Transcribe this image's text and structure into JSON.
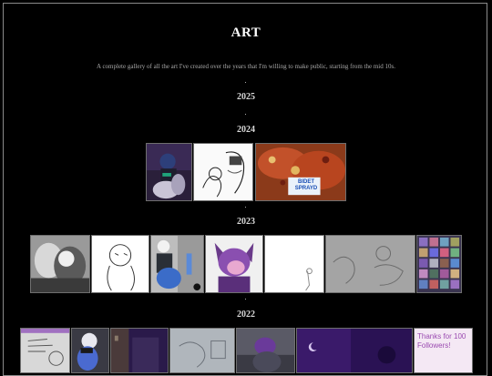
{
  "page": {
    "title": "ART",
    "subtitle": "A complete gallery of all the art I've created over the years that I'm willing to make public, starting from the mid 10s.",
    "separator": "·"
  },
  "years": [
    {
      "label": "2025"
    },
    {
      "label": "2024"
    },
    {
      "label": "2023"
    },
    {
      "label": "2022"
    }
  ],
  "thumbnails": {
    "pizza_sign": "BIDET\nSPRAYD",
    "thanks_note": "Thanks for 100 Followers!"
  },
  "colors": {
    "background": "#000000",
    "frame": "#8a8a8a",
    "heading": "#ffffff",
    "year": "#d8d8d8"
  }
}
